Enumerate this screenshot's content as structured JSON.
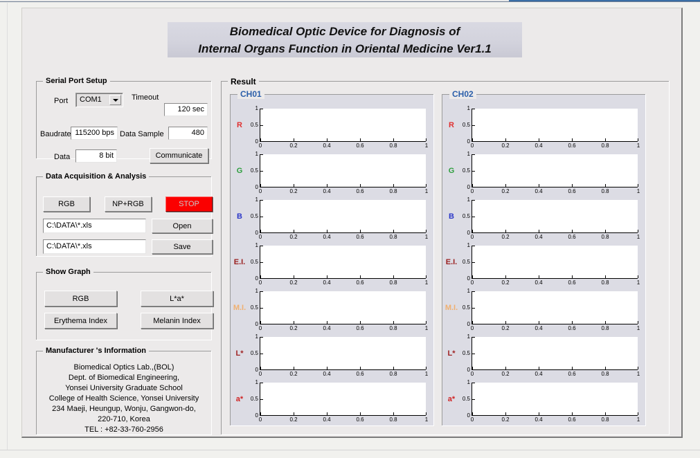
{
  "window": {
    "title_line1": "Biomedical Optic Device for Diagnosis of",
    "title_line2": "Internal Organs Function in Oriental Medicine Ver1.1"
  },
  "serial_port_setup": {
    "legend": "Serial Port Setup",
    "port_label": "Port",
    "port_value": "COM1",
    "timeout_label": "Timeout",
    "timeout_value": "120 sec",
    "baudrate_label": "Baudrate",
    "baudrate_value": "115200 bps",
    "data_sample_label": "Data Sample",
    "data_sample_value": "480",
    "data_label": "Data",
    "data_value": "8 bit",
    "communicate_label": "Communicate"
  },
  "data_acquisition": {
    "legend": "Data Acquisition & Analysis",
    "rgb_label": "RGB",
    "nprgb_label": "NP+RGB",
    "stop_label": "STOP",
    "open_path": "C:\\DATA\\*.xls",
    "open_label": "Open",
    "save_path": "C:\\DATA\\*.xls",
    "save_label": "Save",
    "stop_color": "#fb0000"
  },
  "show_graph": {
    "legend": "Show Graph",
    "rgb_label": "RGB",
    "lab_label": "L*a*",
    "erythema_label": "Erythema Index",
    "melanin_label": "Melanin Index"
  },
  "manufacturer": {
    "legend": "Manufacturer 's Information",
    "lines": [
      "Biomedical Optics Lab.,(BOL)",
      "Dept. of Biomedical Engineering,",
      "Yonsei University Graduate School",
      "College of Health Science, Yonsei University",
      "234 Maeji, Heungup, Wonju, Gangwon-do,",
      "220-710, Korea",
      "TEL : +82-33-760-2956"
    ]
  },
  "result": {
    "legend": "Result",
    "channels": [
      {
        "name": "CH01",
        "color": "#2b5faa"
      },
      {
        "name": "CH02",
        "color": "#2b5faa"
      }
    ],
    "rows": [
      {
        "label": "R",
        "color": "#e03030"
      },
      {
        "label": "G",
        "color": "#2e9e3e"
      },
      {
        "label": "B",
        "color": "#2b37c8"
      },
      {
        "label": "E.I.",
        "color": "#9a2020"
      },
      {
        "label": "M.I.",
        "color": "#f0b070"
      },
      {
        "label": "L*",
        "color": "#a02424"
      },
      {
        "label": "a*",
        "color": "#d02424"
      }
    ]
  },
  "chart_data": {
    "type": "line",
    "title": "",
    "xlabel": "",
    "ylabel": "",
    "xlim": [
      0,
      1
    ],
    "ylim": [
      0,
      1
    ],
    "xticks": [
      "0",
      "0.2",
      "0.4",
      "0.6",
      "0.8",
      "1"
    ],
    "yticks": [
      "0",
      "0.5",
      "1"
    ],
    "grid": false,
    "legend_position": "left",
    "panels": [
      {
        "channel": "CH01",
        "signal": "R",
        "series": []
      },
      {
        "channel": "CH01",
        "signal": "G",
        "series": []
      },
      {
        "channel": "CH01",
        "signal": "B",
        "series": []
      },
      {
        "channel": "CH01",
        "signal": "E.I.",
        "series": []
      },
      {
        "channel": "CH01",
        "signal": "M.I.",
        "series": []
      },
      {
        "channel": "CH01",
        "signal": "L*",
        "series": []
      },
      {
        "channel": "CH01",
        "signal": "a*",
        "series": []
      },
      {
        "channel": "CH02",
        "signal": "R",
        "series": []
      },
      {
        "channel": "CH02",
        "signal": "G",
        "series": []
      },
      {
        "channel": "CH02",
        "signal": "B",
        "series": []
      },
      {
        "channel": "CH02",
        "signal": "E.I.",
        "series": []
      },
      {
        "channel": "CH02",
        "signal": "M.I.",
        "series": []
      },
      {
        "channel": "CH02",
        "signal": "L*",
        "series": []
      },
      {
        "channel": "CH02",
        "signal": "a*",
        "series": []
      }
    ],
    "note": "All 14 plot panels are empty (no data plotted); axes span 0 to 1 on both x and y."
  }
}
